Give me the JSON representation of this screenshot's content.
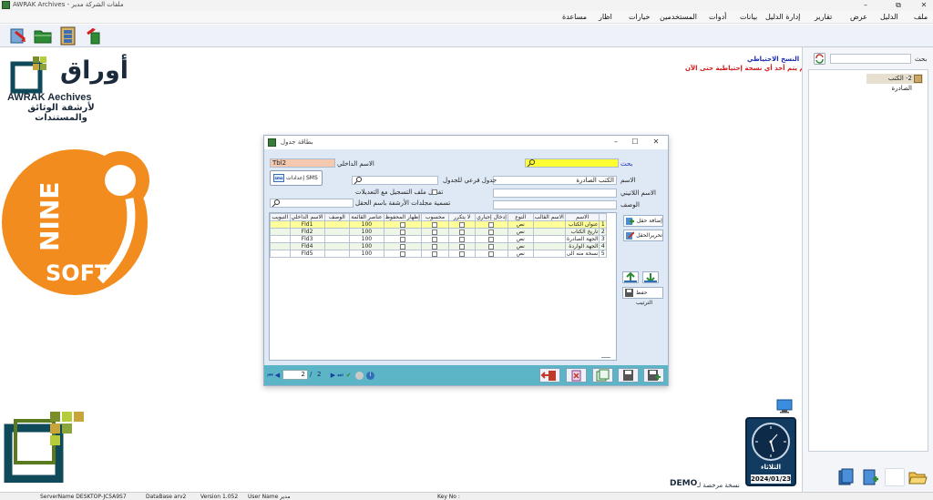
{
  "window": {
    "title": "AWRAK Archives - ملفات الشركة  مدير"
  },
  "menu": [
    "ملف",
    "الدليل",
    "عرض",
    "تقارير",
    "إدارة الدليل",
    "بيانات",
    "أدوات",
    "المستخدمين",
    "خيارات",
    "اظار",
    "مساعدة"
  ],
  "toolbar": {
    "buttons": [
      "exit-icon",
      "open-folder-icon",
      "archive-cabinet-icon",
      "logout-icon"
    ]
  },
  "branding": {
    "logo_ar": "أوراق",
    "logo_en": "AWRAK Aechives",
    "tagline_ar": "لأرشفة الوثائق والمستندات",
    "company_logo_text_1": "NINE",
    "company_logo_text_2": "SOFT",
    "company_logo_digit": "9"
  },
  "backup_notice": {
    "title": "النسخ الاحتياطي",
    "message": "لم يتم أخذ أي نسخة إحتياطية حتى الآن"
  },
  "right_panel": {
    "search_label": "بحث",
    "search_value": "",
    "tree_items": [
      {
        "label": "2- الكتب الصادرة"
      }
    ]
  },
  "clock": {
    "day": "الثلاثاء",
    "date": "2024/01/23"
  },
  "demo": {
    "label": "DEMO",
    "sub": "نسخة مرخصة لـ"
  },
  "status_bar": {
    "server": "ServerName  DESKTOP-JC5A9S7",
    "database": "DataBase  arv2",
    "version": "Version  1.052",
    "user": "User Name  مدير",
    "key": "Key No :"
  },
  "dialog": {
    "title": "بطاقة جدول",
    "search_label": "بحث",
    "search_value": "",
    "internal_name_label": "الاسم الداخلي",
    "internal_name_value": "Tbl2",
    "name_label": "الاسم",
    "name_value": "الكتب الصادرة",
    "latin_name_label": "الاسم اللاتيني",
    "latin_name_value": "",
    "description_label": "الوصف",
    "description_value": "",
    "subtable_label": "جدول فرعي للجدول",
    "subtable_value": "",
    "enable_log_label": "تفعيل ملف التسجيل مع التعديلات",
    "folder_naming_label": "تسمية مجلدات الأرشفة باسم الحقل",
    "sms_button": "إعدادات SMS",
    "add_field_button": "إضافة حقل",
    "edit_field_button": "تحريرالحقل",
    "save_order_button": "حفظ الترتيب",
    "grid": {
      "columns": [
        "",
        "الاسم",
        "الاسم القالب",
        "النوع",
        "إدخال إجباري",
        "لا يتكرر",
        "محسوب",
        "إظهار المحفوظ",
        "عناصر القائمة",
        "الوصف",
        "الاسم الداخلي",
        "التبويب"
      ],
      "rows": [
        {
          "num": "1",
          "name": "عنوان الكتاب",
          "template": "",
          "type": "نص",
          "required": false,
          "unique": false,
          "computed": false,
          "show_saved": false,
          "items": "100",
          "desc": "",
          "internal": "Fld1",
          "tab": ""
        },
        {
          "num": "2",
          "name": "تاريخ الكتاب",
          "template": "",
          "type": "نص",
          "required": false,
          "unique": false,
          "computed": false,
          "show_saved": false,
          "items": "100",
          "desc": "",
          "internal": "Fld2",
          "tab": ""
        },
        {
          "num": "3",
          "name": "الجهة الصادرة",
          "template": "",
          "type": "نص",
          "required": false,
          "unique": false,
          "computed": false,
          "show_saved": false,
          "items": "100",
          "desc": "",
          "internal": "Fld3",
          "tab": ""
        },
        {
          "num": "4",
          "name": "الجهة الواردة",
          "template": "",
          "type": "نص",
          "required": false,
          "unique": false,
          "computed": false,
          "show_saved": false,
          "items": "100",
          "desc": "",
          "internal": "Fld4",
          "tab": ""
        },
        {
          "num": "5",
          "name": "نسخة منه الى",
          "template": "",
          "type": "نص",
          "required": false,
          "unique": false,
          "computed": false,
          "show_saved": false,
          "items": "100",
          "desc": "",
          "internal": "Fld5",
          "tab": ""
        }
      ]
    },
    "pager": {
      "current": "2",
      "separator": "/",
      "total": "2"
    },
    "colors": {
      "footer": "#5cb5c6",
      "search_highlight": "#ffff33",
      "internal_name_bg": "#f4c9b0"
    }
  }
}
